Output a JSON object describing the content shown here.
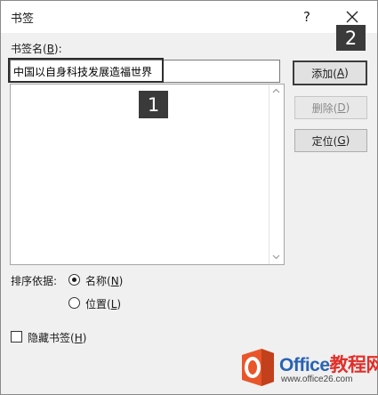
{
  "dialog": {
    "title": "书签",
    "help": "?",
    "close_icon": "close-icon"
  },
  "bookmark_name": {
    "label_prefix": "书签名(",
    "label_key": "B",
    "label_suffix": "):",
    "value": "中国以自身科技发展造福世界"
  },
  "callouts": {
    "one": "1",
    "two": "2"
  },
  "buttons": {
    "add": {
      "prefix": "添加(",
      "key": "A",
      "suffix": ")",
      "state": "default"
    },
    "delete": {
      "prefix": "删除(",
      "key": "D",
      "suffix": ")",
      "state": "disabled"
    },
    "goto": {
      "prefix": "定位(",
      "key": "G",
      "suffix": ")",
      "state": "enabled"
    }
  },
  "sort": {
    "label": "排序依据:",
    "options": [
      {
        "prefix": "名称(",
        "key": "N",
        "suffix": ")",
        "selected": true
      },
      {
        "prefix": "位置(",
        "key": "L",
        "suffix": ")",
        "selected": false
      }
    ]
  },
  "hidden_bookmarks": {
    "prefix": "隐藏书签(",
    "key": "H",
    "suffix": ")",
    "checked": false
  },
  "watermark": {
    "brand_a": "Office",
    "brand_b": "教程网",
    "url": "www.office26.com"
  },
  "colors": {
    "dialog_bg": "#f0f0f0",
    "callout_bg": "#3a3a3a",
    "brand_blue": "#2a62b4",
    "brand_red": "#e0302a",
    "logo_orange": "#e8562a"
  }
}
